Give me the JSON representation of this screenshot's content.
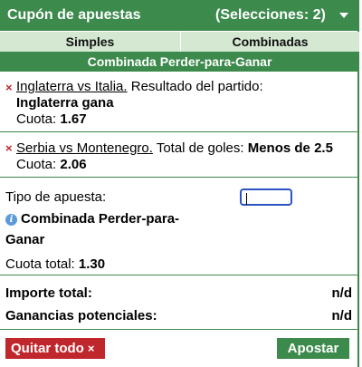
{
  "header": {
    "title": "Cupón de apuestas",
    "selections": "(Selecciones: 2)"
  },
  "tabs": [
    {
      "label": "Simples"
    },
    {
      "label": "Combinadas"
    }
  ],
  "subheader": "Combinada Perder-para-Ganar",
  "selections": [
    {
      "match": "Inglaterra vs Italia.",
      "market": " Resultado del partido:",
      "pick": "Inglaterra gana",
      "odds_label": "Cuota: ",
      "odds": "1.67"
    },
    {
      "match": "Serbia vs Montenegro.",
      "market": " Total de goles: ",
      "pick": "Menos de 2.5",
      "odds_label": "Cuota: ",
      "odds": "2.06"
    }
  ],
  "bet_type": {
    "label": "Tipo de apuesta:",
    "name_line1": "Combinada Perder-para-",
    "name_line2": "Ganar",
    "total_odds_label": "Cuota total: ",
    "total_odds": "1.30",
    "stake_value": ""
  },
  "totals": {
    "total_stake_label": "Importe total:",
    "total_stake_value": "n/d",
    "potential_label": "Ganancias potenciales:",
    "potential_value": "n/d"
  },
  "footer": {
    "remove_all": "Quitar todo",
    "remove_glyph": "×",
    "place_bet": "Apostar"
  },
  "remove_glyph": "×",
  "icons": {
    "info": "i"
  },
  "colors": {
    "green": "#3c8a4c",
    "light_green": "#d4e8d2",
    "red": "#c0272d",
    "input_border": "#2a54c2",
    "info_blue": "#5b9bd8"
  }
}
